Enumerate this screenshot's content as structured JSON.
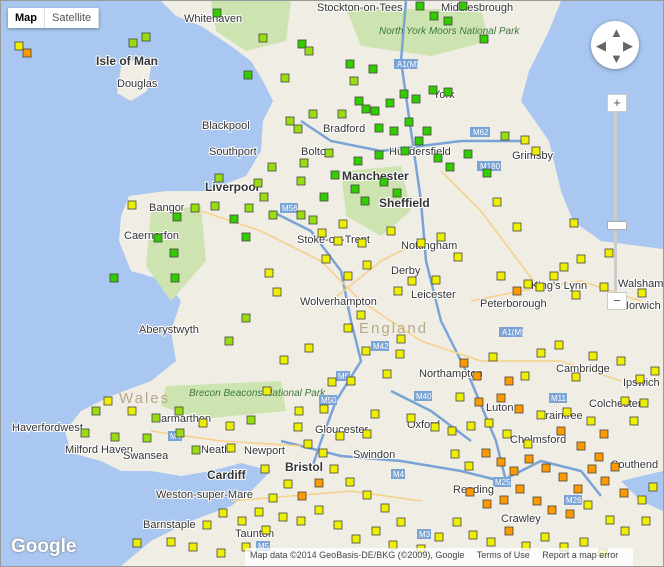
{
  "map_type": {
    "active": "Map",
    "options": [
      "Map",
      "Satellite"
    ]
  },
  "controls": {
    "zoom_in": "+",
    "zoom_out": "−"
  },
  "logo": "Google",
  "attribution": {
    "data": "Map data ©2014 GeoBasis-DE/BKG (©2009), Google",
    "terms": "Terms of Use",
    "report": "Report a map error"
  },
  "places": [
    {
      "name": "Whitehaven"
    },
    {
      "name": "Stockton-on-Tees"
    },
    {
      "name": "Middlesbrough"
    },
    {
      "name": "Isle of Man"
    },
    {
      "name": "Douglas"
    },
    {
      "name": "York"
    },
    {
      "name": "Blackpool"
    },
    {
      "name": "Bradford"
    },
    {
      "name": "Southport"
    },
    {
      "name": "Bolton"
    },
    {
      "name": "Huddersfield"
    },
    {
      "name": "Grimsby"
    },
    {
      "name": "Liverpool"
    },
    {
      "name": "Manchester"
    },
    {
      "name": "Sheffield"
    },
    {
      "name": "Bangor"
    },
    {
      "name": "Caernarfon"
    },
    {
      "name": "Stoke-on-Trent"
    },
    {
      "name": "Nottingham"
    },
    {
      "name": "Derby"
    },
    {
      "name": "Leicester"
    },
    {
      "name": "King's Lynn"
    },
    {
      "name": "Norwich"
    },
    {
      "name": "Walsham"
    },
    {
      "name": "Wolverhampton"
    },
    {
      "name": "Peterborough"
    },
    {
      "name": "England"
    },
    {
      "name": "Aberystwyth"
    },
    {
      "name": "Northampton"
    },
    {
      "name": "Cambridge"
    },
    {
      "name": "Ipswich"
    },
    {
      "name": "Wales"
    },
    {
      "name": "Carmarthen"
    },
    {
      "name": "Haverfordwest"
    },
    {
      "name": "Milford Haven"
    },
    {
      "name": "Swansea"
    },
    {
      "name": "Neath"
    },
    {
      "name": "Newport"
    },
    {
      "name": "Gloucester"
    },
    {
      "name": "Oxford"
    },
    {
      "name": "Luton"
    },
    {
      "name": "Braintree"
    },
    {
      "name": "Colchester"
    },
    {
      "name": "Chelmsford"
    },
    {
      "name": "Southend"
    },
    {
      "name": "Cardiff"
    },
    {
      "name": "Bristol"
    },
    {
      "name": "Swindon"
    },
    {
      "name": "Reading"
    },
    {
      "name": "Crawley"
    },
    {
      "name": "Weston-super-Mare"
    },
    {
      "name": "Barnstaple"
    },
    {
      "name": "Taunton"
    }
  ],
  "parks": [
    {
      "name": "North York Moors National Park"
    },
    {
      "name": "Brecon Beacons National Park"
    }
  ],
  "roads": [
    "A1(M)",
    "M62",
    "M180",
    "M56",
    "A1(M)",
    "M42",
    "M5",
    "M40",
    "M11",
    "M50",
    "M4",
    "M4",
    "M25",
    "M26",
    "M3",
    "M5"
  ],
  "colors": {
    "sea": "#a9c7f0",
    "land": "#f0ede5",
    "park": "#cde4b1",
    "motorway": "#7aa3d6",
    "road": "#f5d28a"
  },
  "sensor_legend": {
    "green": "#33cc00",
    "light_green": "#99dd11",
    "yellow": "#eeee00",
    "orange": "#ff9900"
  }
}
